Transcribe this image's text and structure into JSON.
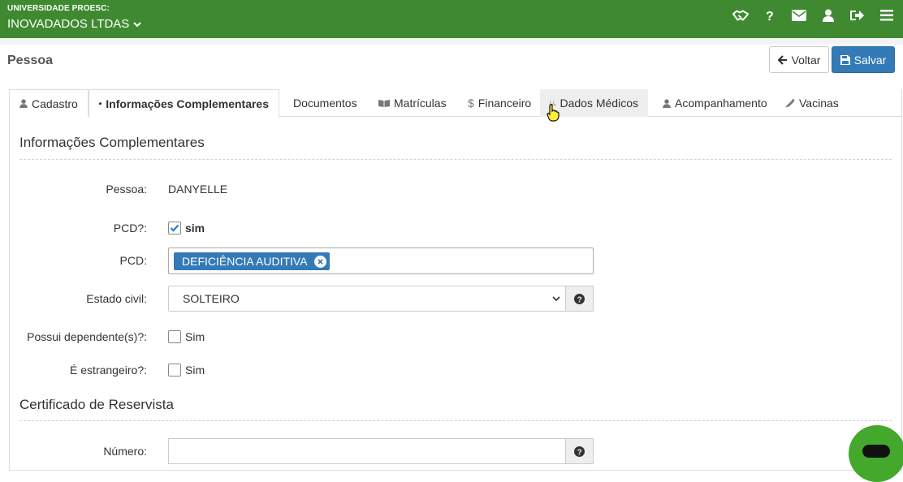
{
  "header": {
    "org_small": "UNIVERSIDADE PROESC:",
    "org_name": "INOVADADOS LTDAS",
    "icons": [
      "handshake-icon",
      "help-icon",
      "mail-icon",
      "user-icon",
      "logout-icon",
      "menu-icon"
    ],
    "brand_color": "#3f8a31"
  },
  "page": {
    "title": "Pessoa",
    "back_label": "Voltar",
    "save_label": "Salvar"
  },
  "tabs": [
    {
      "label": "Cadastro",
      "icon": "user-icon"
    },
    {
      "label": "Informações Complementares",
      "icon": "briefcase-icon",
      "active": true
    },
    {
      "label": "Documentos",
      "icon": ""
    },
    {
      "label": "Matrículas",
      "icon": "book-icon"
    },
    {
      "label": "Financeiro",
      "icon": "dollar-icon"
    },
    {
      "label": "Dados Médicos",
      "icon": "stethoscope-icon",
      "hover": true
    },
    {
      "label": "Acompanhamento",
      "icon": "user-md-icon"
    },
    {
      "label": "Vacinas",
      "icon": "syringe-icon"
    }
  ],
  "form": {
    "section_title": "Informações Complementares",
    "pessoa_label": "Pessoa:",
    "pessoa_value": "DANYELLE",
    "pcd_check_label": "PCD?:",
    "pcd_check_value": "sim",
    "pcd_label": "PCD:",
    "pcd_tags": [
      "DEFICIÊNCIA AUDITIVA"
    ],
    "estado_civil_label": "Estado civil:",
    "estado_civil_value": "SOLTEIRO",
    "dependentes_label": "Possui dependente(s)?:",
    "dependentes_value": "Sim",
    "estrangeiro_label": "É estrangeiro?:",
    "estrangeiro_value": "Sim",
    "reservista_title": "Certificado de Reservista",
    "numero_label": "Número:"
  }
}
